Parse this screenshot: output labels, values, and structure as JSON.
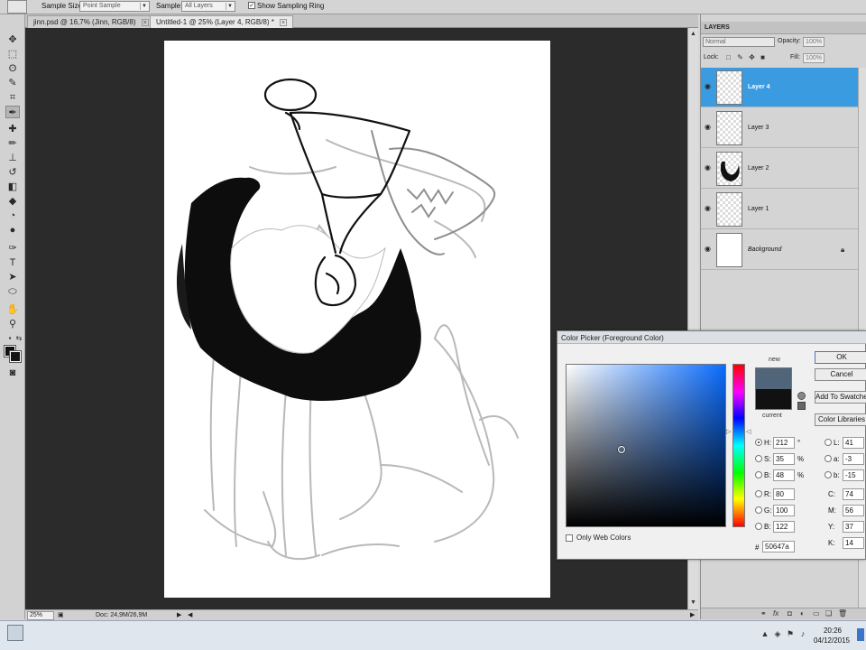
{
  "options_bar": {
    "sample_size_label": "Sample Size:",
    "sample_size_value": "Point Sample",
    "sample_label": "Sample:",
    "sample_value": "All Layers",
    "show_ring_label": "Show Sampling Ring",
    "show_ring_checked": true
  },
  "tabs": [
    {
      "label": "jinn.psd @ 16,7% (Jinn, RGB/8)",
      "active": false
    },
    {
      "label": "Untitled-1 @ 25% (Layer 4, RGB/8) *",
      "active": true
    }
  ],
  "status": {
    "zoom": "25%",
    "doc": "Doc: 24,9M/26,9M"
  },
  "layers_panel": {
    "title": "LAYERS",
    "blend_mode": "Normal",
    "opacity_label": "Opacity:",
    "opacity_value": "100%",
    "lock_label": "Lock:",
    "fill_label": "Fill:",
    "fill_value": "100%",
    "layers": [
      {
        "name": "Layer 4",
        "active": true,
        "visible": true
      },
      {
        "name": "Layer 3",
        "active": false,
        "visible": true
      },
      {
        "name": "Layer 2",
        "active": false,
        "visible": true
      },
      {
        "name": "Layer 1",
        "active": false,
        "visible": true
      },
      {
        "name": "Background",
        "active": false,
        "visible": true,
        "locked": true
      }
    ]
  },
  "color_picker": {
    "title": "Color Picker (Foreground Color)",
    "new_label": "new",
    "current_label": "current",
    "new_color": "#50647a",
    "current_color": "#111111",
    "buttons": {
      "ok": "OK",
      "cancel": "Cancel",
      "add_to_swatches": "Add To Swatches",
      "color_libraries": "Color Libraries"
    },
    "hsb": [
      {
        "key": "H:",
        "value": "212",
        "unit": "°",
        "selected": true
      },
      {
        "key": "S:",
        "value": "35",
        "unit": "%",
        "selected": false
      },
      {
        "key": "B:",
        "value": "48",
        "unit": "%",
        "selected": false
      }
    ],
    "rgb": [
      {
        "key": "R:",
        "value": "80"
      },
      {
        "key": "G:",
        "value": "100"
      },
      {
        "key": "B:",
        "value": "122"
      }
    ],
    "lab": [
      {
        "key": "L:",
        "value": "41"
      },
      {
        "key": "a:",
        "value": "-3"
      },
      {
        "key": "b:",
        "value": "-15"
      }
    ],
    "cmyk": [
      {
        "key": "C:",
        "value": "74"
      },
      {
        "key": "M:",
        "value": "56"
      },
      {
        "key": "Y:",
        "value": "37"
      },
      {
        "key": "K:",
        "value": "14"
      }
    ],
    "only_web_colors_label": "Only Web Colors",
    "hex_label": "#",
    "hex_value": "50647a"
  },
  "taskbar": {
    "time": "20:26",
    "date": "04/12/2015"
  },
  "icons": [
    "eyedropper-tool-icon",
    "move-tool-icon",
    "eye-icon",
    "lock-icon",
    "fx-icon"
  ]
}
